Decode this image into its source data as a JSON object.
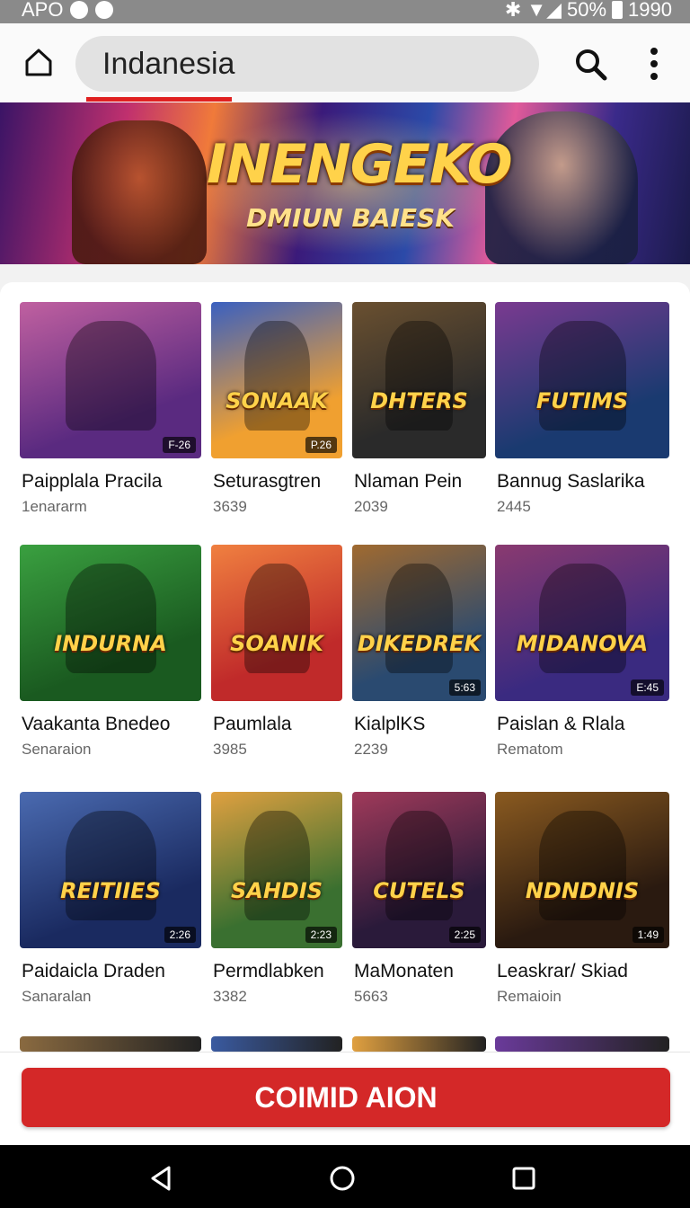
{
  "status": {
    "left_text": "APO",
    "battery_text": "50%",
    "time": "1990"
  },
  "topbar": {
    "address_text": "Indanesia"
  },
  "banner": {
    "title": "INENGEKO",
    "subtitle": "DMIUN BAIESK"
  },
  "colors": {
    "accent": "#d42828",
    "status_bg": "#8a8a8a"
  },
  "cards": [
    {
      "title": "Paipplala Pracila",
      "sub": "1enararm",
      "badge": "F-26",
      "logo": "",
      "c1": "#5a2a80",
      "c2": "#c060a0"
    },
    {
      "title": "Seturasgtren",
      "sub": "3639",
      "badge": "P.26",
      "logo": "SONAAK",
      "c1": "#f0a030",
      "c2": "#3a60c0"
    },
    {
      "title": "Nlaman Pein",
      "sub": "2039",
      "badge": "",
      "logo": "DHTERS",
      "c1": "#2a2a2a",
      "c2": "#6a5030"
    },
    {
      "title": "Bannug Saslarika",
      "sub": "2445",
      "badge": "",
      "logo": "FUTIMS",
      "c1": "#1a3a70",
      "c2": "#7a3a90"
    },
    {
      "title": "Vaakanta Bnedeo",
      "sub": "Senaraion",
      "badge": "",
      "logo": "INDURNA",
      "c1": "#1a5a20",
      "c2": "#3aa040"
    },
    {
      "title": "Paumlala",
      "sub": "3985",
      "badge": "",
      "logo": "SOANIK",
      "c1": "#c02a2a",
      "c2": "#f08040"
    },
    {
      "title": "KialplKS",
      "sub": "2239",
      "badge": "5:63",
      "logo": "DIKEDREK",
      "c1": "#2a4a70",
      "c2": "#a06a30"
    },
    {
      "title": "Paislan & Rlala",
      "sub": "Rematom",
      "badge": "E:45",
      "logo": "MIDANOVA",
      "c1": "#3a2a80",
      "c2": "#8a3a70"
    },
    {
      "title": "Paidaicla Draden",
      "sub": "Sanaralan",
      "badge": "2:26",
      "logo": "REITIIES",
      "c1": "#1a2a60",
      "c2": "#4a6ab0"
    },
    {
      "title": "Permdlabken",
      "sub": "3382",
      "badge": "2:23",
      "logo": "SAHDIS",
      "c1": "#3a7030",
      "c2": "#e0a040"
    },
    {
      "title": "MaMonaten",
      "sub": "5663",
      "badge": "2:25",
      "logo": "CUTELS",
      "c1": "#2a1a3a",
      "c2": "#a03a5a"
    },
    {
      "title": "Leaskrar/ Skiad",
      "sub": "Remaioin",
      "badge": "1:49",
      "logo": "NDNDNIS",
      "c1": "#2a1a10",
      "c2": "#8a5a20"
    }
  ],
  "partial_colors": [
    "#8a6a40",
    "#3a5aa0",
    "#e0a040",
    "#6a3a9a"
  ],
  "cta": {
    "label": "COIMID AION"
  }
}
